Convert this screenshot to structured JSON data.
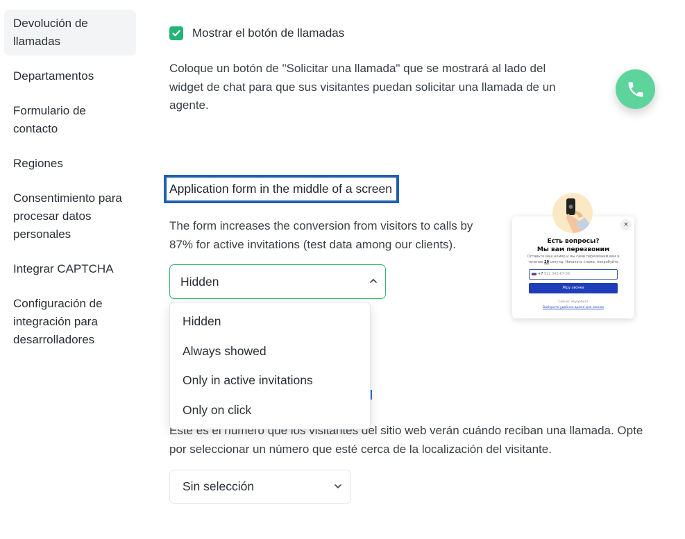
{
  "sidebar": {
    "items": [
      {
        "label": "Devolución de llamadas",
        "active": true
      },
      {
        "label": "Departamentos"
      },
      {
        "label": "Formulario de contacto"
      },
      {
        "label": "Regiones"
      },
      {
        "label": "Consentimiento para procesar datos personales"
      },
      {
        "label": "Integrar CAPTCHA"
      },
      {
        "label": "Configuración de integración para desarrolladores"
      }
    ]
  },
  "callback": {
    "show_button_label": "Mostrar el botón de llamadas",
    "show_button_checked": true,
    "description": "Coloque un botón de \"Solicitar una llamada\" que se mostrará al lado del widget de chat para que sus visitantes puedan solicitar una llamada de un agente.",
    "fab_icon": "phone-icon"
  },
  "application_form": {
    "title": "Application form in the middle of a screen",
    "description": "The form increases the conversion from visitors to calls by 87% for active invitations (test data among our clients).",
    "selected": "Hidden",
    "options": [
      "Hidden",
      "Always showed",
      "Only in active invitations",
      "Only on click"
    ]
  },
  "phone_number": {
    "description": "Este es el número que los visitantes del sitio web verán cuándo reciban una llamada. Opte por seleccionar un número que esté cerca de la localización del visitante.",
    "selected": "Sin selección"
  },
  "preview": {
    "close": "×",
    "title_line1": "Есть вопросы?",
    "title_line2": "Мы вам перезвоним",
    "subtitle_pre": "Оставьте ваш номер и мы сами перезвоним вам в течение ",
    "subtitle_num": "29",
    "subtitle_post": " секунд. Никакого спама, попробуйте",
    "phone_prefix": "+7",
    "phone_placeholder": "912 345-67-89",
    "button": "Жду звонка",
    "footer1": "Сейчас неудобно?",
    "footer2": "Выберите удобное время для звонка"
  },
  "colors": {
    "accent_green": "#22b573",
    "fab_green": "#5ed49d",
    "highlight_blue": "#1f5fb0"
  }
}
